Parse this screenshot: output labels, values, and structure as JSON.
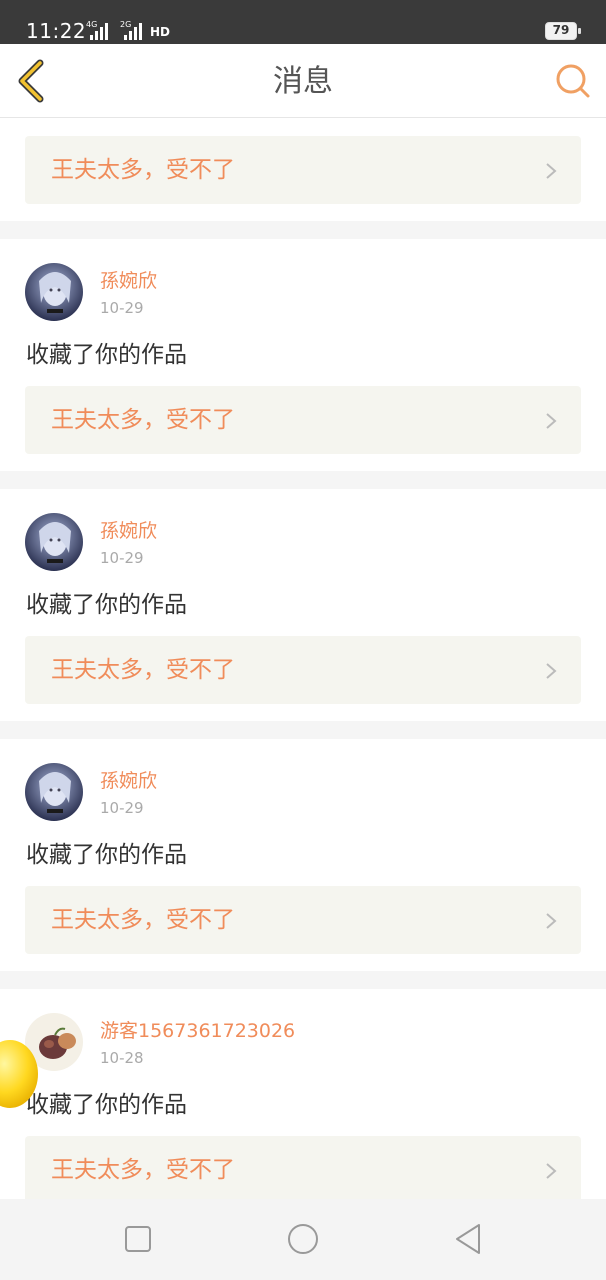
{
  "status_bar": {
    "time": "11:22",
    "network": [
      {
        "tag": "4G"
      },
      {
        "tag": "2G"
      }
    ],
    "hd_label": "HD",
    "battery": "79"
  },
  "nav": {
    "title": "消息",
    "back_icon": "chevron-left-icon",
    "search_icon": "search-icon",
    "accent_color": "#f0a063"
  },
  "top_work": {
    "title": "王夫太多，受不了"
  },
  "notifications": [
    {
      "username": "孫婉欣",
      "date": "10-29",
      "action": "收藏了你的作品",
      "work_title": "王夫太多，受不了",
      "avatar": "anime-avatar"
    },
    {
      "username": "孫婉欣",
      "date": "10-29",
      "action": "收藏了你的作品",
      "work_title": "王夫太多，受不了",
      "avatar": "anime-avatar"
    },
    {
      "username": "孫婉欣",
      "date": "10-29",
      "action": "收藏了你的作品",
      "work_title": "王夫太多，受不了",
      "avatar": "anime-avatar"
    },
    {
      "username": "游客1567361723026",
      "date": "10-28",
      "action": "收藏了你的作品",
      "work_title": "王夫太多，受不了",
      "avatar": "fruit-avatar"
    }
  ],
  "colors": {
    "orange_text": "#f08c5a",
    "card_bg": "#f5f5ef",
    "page_bg": "#f5f5f5"
  },
  "system_nav": {
    "buttons": [
      "square-icon",
      "circle-icon",
      "triangle-back-icon"
    ]
  }
}
